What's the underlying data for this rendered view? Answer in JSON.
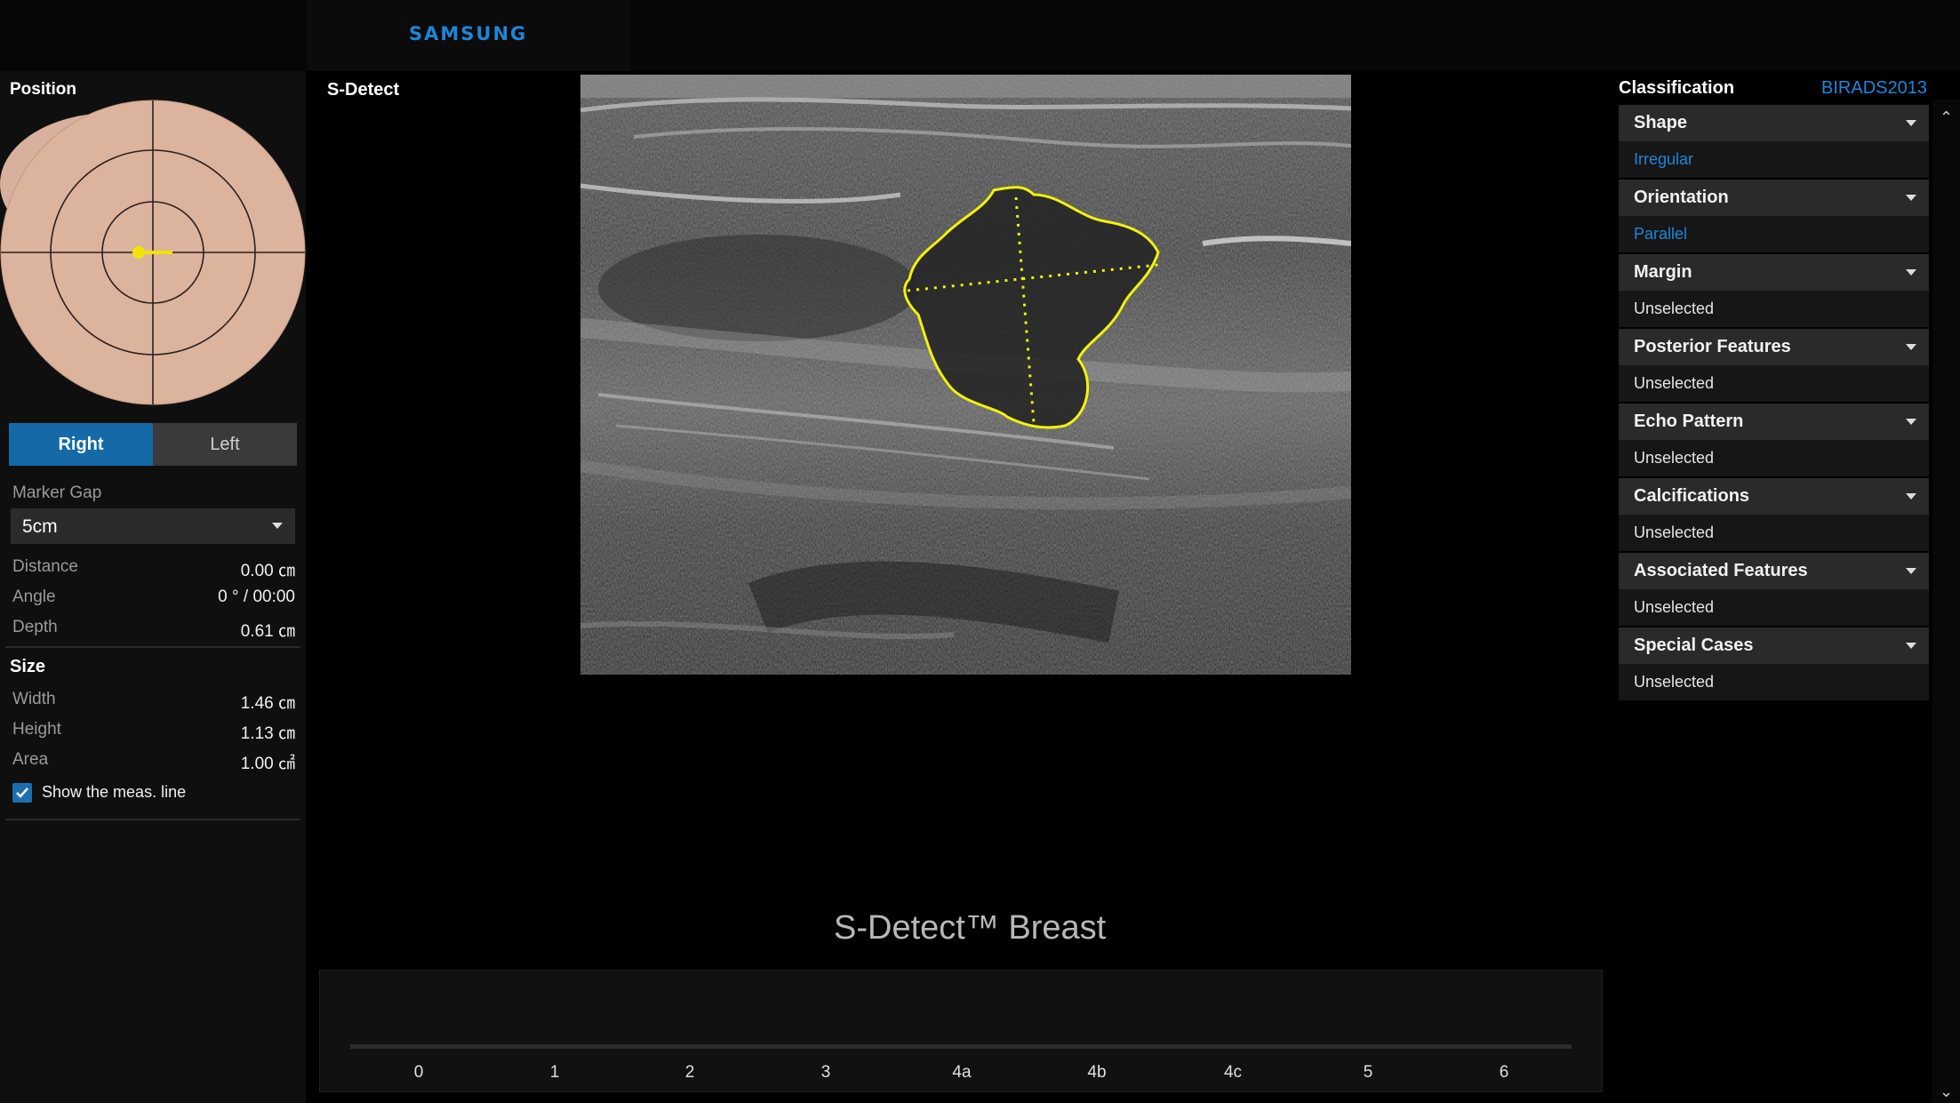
{
  "header": {
    "brand": "SAMSUNG"
  },
  "left": {
    "position_title": "Position",
    "side": {
      "right": "Right",
      "left": "Left",
      "selected": "Right"
    },
    "marker_gap": {
      "label": "Marker Gap",
      "value": "5cm"
    },
    "measurements": [
      {
        "label": "Distance",
        "value": "0.00 ㎝"
      },
      {
        "label": "Angle",
        "value": "0 °  /  00:00"
      },
      {
        "label": "Depth",
        "value": "0.61 ㎝"
      }
    ],
    "size_title": "Size",
    "size": [
      {
        "label": "Width",
        "value": "1.46 ㎝"
      },
      {
        "label": "Height",
        "value": "1.13 ㎝"
      },
      {
        "label": "Area",
        "value": "1.00 ㎠"
      }
    ],
    "show_meas_line": {
      "label": "Show the meas. line",
      "checked": true
    }
  },
  "center": {
    "title": "S-Detect",
    "product_title": "S-Detect™ Breast",
    "scale_ticks": [
      "0",
      "1",
      "2",
      "3",
      "4a",
      "4b",
      "4c",
      "5",
      "6"
    ]
  },
  "right": {
    "title": "Classification",
    "standard": "BIRADS2013",
    "categories": [
      {
        "name": "Shape",
        "value": "Irregular",
        "selected": true
      },
      {
        "name": "Orientation",
        "value": "Parallel",
        "selected": true
      },
      {
        "name": "Margin",
        "value": "Unselected",
        "selected": false
      },
      {
        "name": "Posterior Features",
        "value": "Unselected",
        "selected": false
      },
      {
        "name": "Echo Pattern",
        "value": "Unselected",
        "selected": false
      },
      {
        "name": "Calcifications",
        "value": "Unselected",
        "selected": false
      },
      {
        "name": "Associated Features",
        "value": "Unselected",
        "selected": false
      },
      {
        "name": "Special Cases",
        "value": "Unselected",
        "selected": false
      }
    ]
  },
  "colors": {
    "accent": "#1c86d9",
    "lesion_outline": "#f2f20a",
    "toggle_active": "#1569a6"
  }
}
